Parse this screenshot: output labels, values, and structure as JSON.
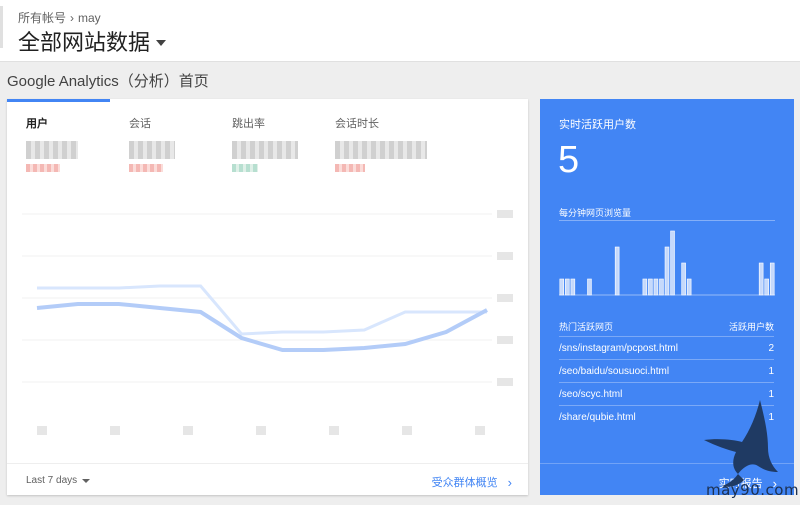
{
  "header": {
    "breadcrumb_root": "所有帐号",
    "breadcrumb_account": "may",
    "view_title": "全部网站数据"
  },
  "page": {
    "title": "Google Analytics（分析）首页"
  },
  "metrics": [
    {
      "label": "用户",
      "active": true
    },
    {
      "label": "会话",
      "active": false
    },
    {
      "label": "跳出率",
      "active": false
    },
    {
      "label": "会话时长",
      "active": false
    }
  ],
  "chart_data": {
    "type": "line",
    "series": [
      {
        "values": [
          0.63,
          0.63,
          0.63,
          0.64,
          0.64,
          0.4,
          0.41,
          0.41,
          0.42,
          0.51,
          0.51,
          0.51
        ]
      },
      {
        "values": [
          0.53,
          0.55,
          0.55,
          0.53,
          0.51,
          0.38,
          0.32,
          0.32,
          0.33,
          0.35,
          0.41,
          0.52
        ]
      }
    ]
  },
  "left_footer": {
    "date_range": "Last 7 days",
    "link": "受众群体概览"
  },
  "realtime": {
    "title": "实时活跃用户数",
    "count": "5",
    "pageviews_label": "每分钟网页浏览量",
    "bars": [
      0.2,
      0.2,
      0.2,
      0,
      0,
      0.2,
      0,
      0,
      0,
      0,
      0.6,
      0,
      0,
      0,
      0,
      0.2,
      0.2,
      0.2,
      0.2,
      0.6,
      0.8,
      0,
      0.4,
      0.2,
      0,
      0,
      0,
      0,
      0,
      0,
      0,
      0,
      0,
      0,
      0,
      0,
      0.4,
      0.2,
      0.4
    ],
    "table_head_page": "热门活跃网页",
    "table_head_users": "活跃用户数",
    "rows": [
      {
        "page": "/sns/instagram/pcpost.html",
        "users": "2"
      },
      {
        "page": "/seo/baidu/sousuoci.html",
        "users": "1"
      },
      {
        "page": "/seo/scyc.html",
        "users": "1"
      },
      {
        "page": "/share/qubie.html",
        "users": "1"
      }
    ],
    "footer_link": "实时报告"
  },
  "watermark": {
    "text": "may90.com"
  },
  "colors": {
    "accent": "#4285f4",
    "line_light": "#d8e6fd",
    "line_main": "#b3ccf8"
  }
}
